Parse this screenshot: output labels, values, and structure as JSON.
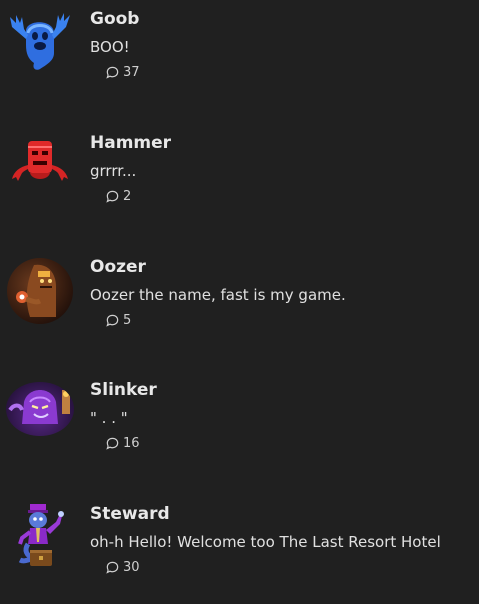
{
  "posts": [
    {
      "name": "Goob",
      "text": "BOO!",
      "replies": "37",
      "avatar": "blue-ghost-goob"
    },
    {
      "name": "Hammer",
      "text": "grrrr...",
      "replies": "2",
      "avatar": "red-ghost-hammer"
    },
    {
      "name": "Oozer",
      "text": "Oozer the name, fast is my game.",
      "replies": "5",
      "avatar": "brown-ghost-oozer"
    },
    {
      "name": "Slinker",
      "text": "\" . . \"",
      "replies": "16",
      "avatar": "purple-ghost-slinker"
    },
    {
      "name": "Steward",
      "text": "oh-h Hello! Welcome too The Last Resort Hotel",
      "replies": "30",
      "avatar": "purple-ghost-steward"
    }
  ],
  "reply_icon": "speech-bubble-icon"
}
